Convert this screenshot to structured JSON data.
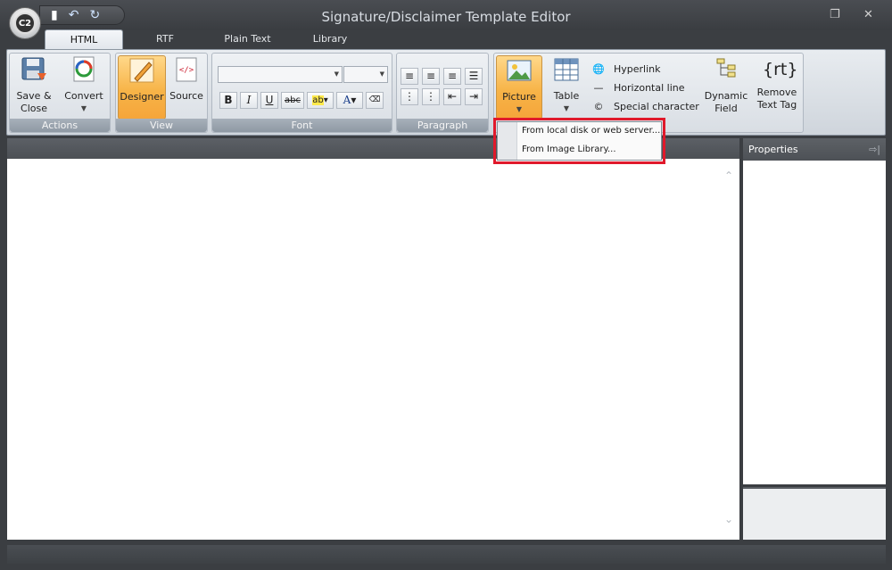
{
  "window": {
    "title": "Signature/Disclaimer Template Editor",
    "logo_text": "C2"
  },
  "tabs": [
    {
      "label": "HTML",
      "active": true
    },
    {
      "label": "RTF",
      "active": false
    },
    {
      "label": "Plain Text",
      "active": false
    },
    {
      "label": "Library",
      "active": false
    }
  ],
  "ribbon": {
    "actions": {
      "label": "Actions",
      "save": "Save &\nClose",
      "convert": "Convert"
    },
    "view": {
      "label": "View",
      "designer": "Designer",
      "source": "Source"
    },
    "font": {
      "label": "Font"
    },
    "paragraph": {
      "label": "Paragraph"
    },
    "insert": {
      "picture": "Picture",
      "table": "Table",
      "hyperlink": "Hyperlink",
      "horizontal_line": "Horizontal line",
      "special_character": "Special character",
      "dynamic_field": "Dynamic\nField",
      "remove_text_tag": "Remove\nText Tag"
    }
  },
  "picture_menu": {
    "items": [
      "From local disk or web server...",
      "From Image Library..."
    ]
  },
  "properties": {
    "title": "Properties"
  },
  "colors": {
    "accent": "#f5a53a",
    "highlight_border": "#e0192b"
  }
}
